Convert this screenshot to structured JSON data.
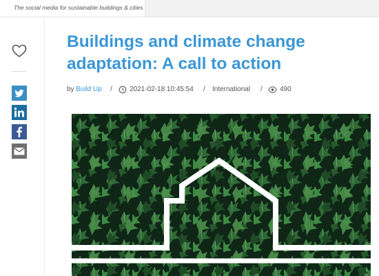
{
  "site": {
    "tagline": "The social media for sustainable buildings & cities"
  },
  "sidebar": {
    "like_icon": "heart-icon",
    "share_buttons": [
      {
        "icon": "twitter-icon",
        "color": "#3a8fc3"
      },
      {
        "icon": "linkedin-icon",
        "color": "#1a6fa0"
      },
      {
        "icon": "facebook-icon",
        "color": "#3b5a96"
      },
      {
        "icon": "email-icon",
        "color": "#6f6f6f"
      }
    ]
  },
  "article": {
    "title": "Buildings and climate change adaptation: A call to action",
    "meta": {
      "by_label": "by",
      "author": "Build Up",
      "separator": "/",
      "timestamp": "2021-02-18 10:45:54",
      "region": "International",
      "views": "490",
      "clock_icon": "clock-icon",
      "eye_icon": "eye-icon"
    },
    "hero_image": {
      "description_icon": "ivy-house-outline-image"
    }
  },
  "colors": {
    "title": "#3a97d6",
    "link": "#3a97d6",
    "ivy_dark": "#0f2616",
    "ivy_leaf": "#2f6a36"
  }
}
